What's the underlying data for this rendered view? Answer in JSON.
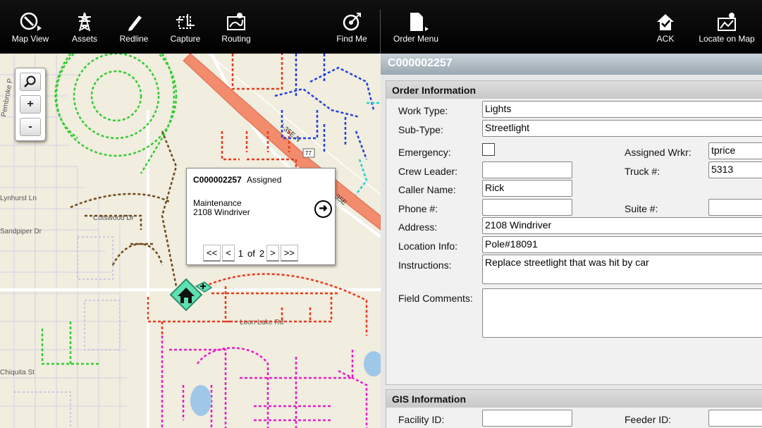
{
  "toolbar": {
    "map_view": "Map View",
    "assets": "Assets",
    "redline": "Redline",
    "capture": "Capture",
    "routing": "Routing",
    "find_me": "Find Me",
    "order_menu": "Order Menu",
    "ack": "ACK",
    "locate_on_map": "Locate on Map"
  },
  "map": {
    "zoom_in": "+",
    "zoom_out": "-",
    "street_labels": [
      "Pembroke P",
      "Lynhurst Ln",
      "Sandpiper Dr",
      "Chiquita St",
      "Cotswood Dr",
      "Loon Lake Rd",
      "I-35E N",
      "I-35E",
      "77"
    ],
    "popup": {
      "order_id": "C000002257",
      "status": "Assigned",
      "type": "Maintenance",
      "address": "2108 Windriver",
      "first": "<<",
      "prev": "<",
      "page": "1",
      "of": "of",
      "total": "2",
      "next": ">",
      "last": ">>"
    }
  },
  "panel": {
    "order_number": "C000002257",
    "order_section": "Order Information",
    "gis_section": "GIS Information",
    "fields": {
      "work_type_label": "Work Type:",
      "work_type": "Lights",
      "sub_type_label": "Sub-Type:",
      "sub_type": "Streetlight",
      "emergency_label": "Emergency:",
      "assigned_label": "Assigned Wrkr:",
      "assigned": "tprice",
      "crew_label": "Crew Leader:",
      "crew": "",
      "truck_label": "Truck #:",
      "truck": "5313",
      "caller_label": "Caller Name:",
      "caller": "Rick",
      "phone_label": "Phone #:",
      "phone": "",
      "suite_label": "Suite #:",
      "suite": "",
      "address_label": "Address:",
      "address": "2108 Windriver",
      "location_label": "Location Info:",
      "location": "Pole#18091",
      "instructions_label": "Instructions:",
      "instructions": "Replace streetlight that was hit by car",
      "comments_label": "Field Comments:",
      "comments": "",
      "facility_label": "Facility ID:",
      "facility": "",
      "feeder_label": "Feeder ID:",
      "feeder": ""
    }
  }
}
